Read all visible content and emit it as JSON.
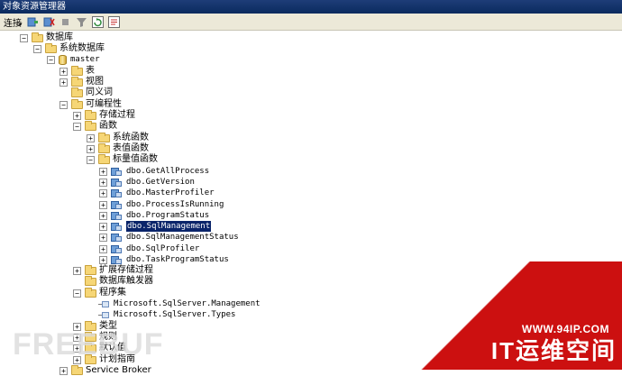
{
  "window": {
    "title": "对象资源管理器"
  },
  "toolbar": {
    "connect_label": "连接",
    "connect_arrow": "▾",
    "buttons": [
      {
        "name": "connect-object-explorer-button",
        "icon": "plug-icon"
      },
      {
        "name": "disconnect-button",
        "icon": "unplug-icon"
      },
      {
        "name": "stop-button",
        "icon": "stop-icon"
      },
      {
        "name": "filter-button",
        "icon": "filter-icon"
      },
      {
        "name": "refresh-button",
        "icon": "refresh-icon"
      },
      {
        "name": "summary-button",
        "icon": "summary-icon"
      }
    ]
  },
  "tree": {
    "databases": "数据库",
    "system_databases": "系统数据库",
    "master": "master",
    "tables": "表",
    "views": "视图",
    "synonyms": "同义词",
    "programmability": "可编程性",
    "stored_procedures": "存储过程",
    "functions": "函数",
    "system_functions": "系统函数",
    "table_valued_functions": "表值函数",
    "scalar_functions": "标量值函数",
    "scalar_items": [
      "dbo.GetAllProcess",
      "dbo.GetVersion",
      "dbo.MasterProfiler",
      "dbo.ProcessIsRunning",
      "dbo.ProgramStatus",
      "dbo.SqlManagement",
      "dbo.SqlManagementStatus",
      "dbo.SqlProfiler",
      "dbo.TaskProgramStatus"
    ],
    "extended_stored_procedures": "扩展存储过程",
    "database_triggers": "数据库触发器",
    "assemblies": "程序集",
    "assembly_items": [
      "Microsoft.SqlServer.Management",
      "Microsoft.SqlServer.Types"
    ],
    "types": "类型",
    "rules": "规则",
    "defaults": "默认值",
    "plan_guides": "计划指南",
    "service_broker": "Service Broker"
  },
  "watermark": {
    "left_text": "FREEBUF",
    "url": "WWW.94IP.COM",
    "brand": "IT运维空间"
  },
  "colors": {
    "title_bar": "#0a2a5e",
    "selection": "#0a246a",
    "watermark_red": "#cc1010"
  }
}
